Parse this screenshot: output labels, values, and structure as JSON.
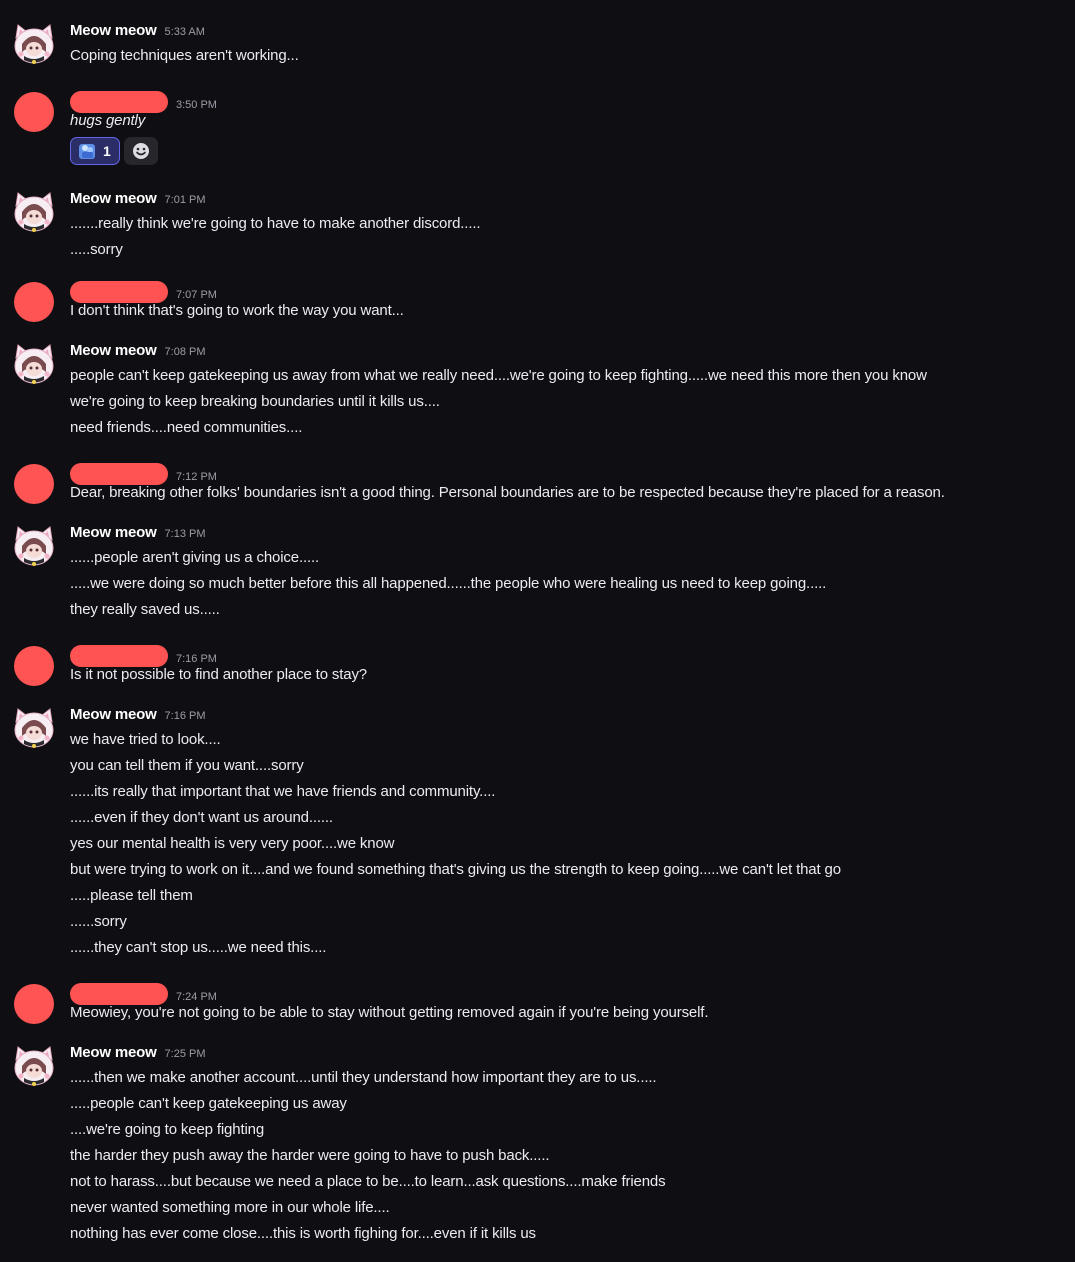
{
  "messages": [
    {
      "author": "Meow meow",
      "author_type": "meow",
      "time": "5:33 AM",
      "lines": [
        "Coping techniques aren't working..."
      ]
    },
    {
      "author": "",
      "author_type": "redacted",
      "time": "3:50 PM",
      "lines": [
        "hugs gently"
      ],
      "italic": true,
      "reactions": [
        {
          "emoji": "hug-emoji",
          "count": "1",
          "selected": true
        }
      ],
      "add_reaction_icon": "add-reaction-smiley-icon"
    },
    {
      "author": "Meow meow",
      "author_type": "meow",
      "time": "7:01 PM",
      "lines": [
        ".......really think we're going to have to make another discord.....",
        ".....sorry"
      ]
    },
    {
      "author": "",
      "author_type": "redacted",
      "time": "7:07 PM",
      "lines": [
        "I don't think that's going to work the way you want..."
      ]
    },
    {
      "author": "Meow meow",
      "author_type": "meow",
      "time": "7:08 PM",
      "lines": [
        "people can't keep gatekeeping us away from what we really need....we're going to keep fighting.....we need this more then you know",
        "we're going to keep breaking boundaries until it kills us....",
        "need friends....need communities...."
      ]
    },
    {
      "author": "",
      "author_type": "redacted",
      "time": "7:12 PM",
      "lines": [
        "Dear, breaking other folks' boundaries isn't a good thing. Personal boundaries are to be respected because they're placed for a reason."
      ]
    },
    {
      "author": "Meow meow",
      "author_type": "meow",
      "time": "7:13 PM",
      "lines": [
        "......people aren't giving us a choice.....",
        ".....we were doing so much better before this all happened......the people who were healing us need to keep going.....",
        "they really saved us....."
      ]
    },
    {
      "author": "",
      "author_type": "redacted",
      "time": "7:16 PM",
      "lines": [
        "Is it not possible to find another place to stay?"
      ]
    },
    {
      "author": "Meow meow",
      "author_type": "meow",
      "time": "7:16 PM",
      "lines": [
        "we have tried to look....",
        "you can tell them if you want....sorry",
        "......its really that important that we have friends and community....",
        "......even if they don't want us around......",
        "yes our mental health is very very poor....we know",
        "but were trying to work on it....and we found something that's giving us the strength to keep going.....we can't let that go",
        ".....please tell them",
        "......sorry",
        "......they can't stop us.....we need this...."
      ]
    },
    {
      "author": "",
      "author_type": "redacted",
      "time": "7:24 PM",
      "lines": [
        "Meowiey, you're not going to be able to stay without getting removed again if you're being yourself."
      ]
    },
    {
      "author": "Meow meow",
      "author_type": "meow",
      "time": "7:25 PM",
      "lines": [
        "......then we make another account....until they understand how important they are to us.....",
        ".....people can't keep gatekeeping us away",
        "....we're going to keep fighting",
        "the harder they push away the harder were going to have to push back.....",
        "not to harass....but because we need a place to be....to learn...ask questions....make friends",
        "never wanted something more in our whole life....",
        "nothing has ever come close....this is worth fighing for....even if it kills us"
      ]
    }
  ]
}
